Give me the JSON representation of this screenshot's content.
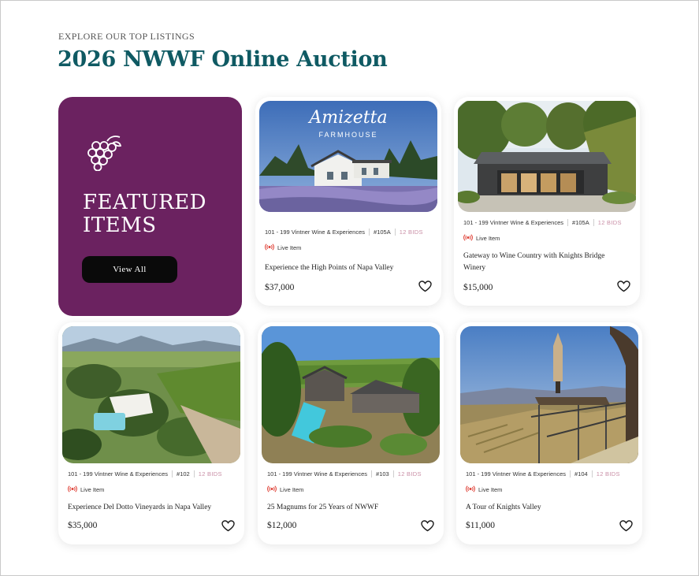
{
  "header": {
    "eyebrow": "EXPLORE OUR TOP LISTINGS",
    "title": "2026 NWWF Online Auction"
  },
  "featured": {
    "title_line1": "FEATURED",
    "title_line2": "ITEMS",
    "button_label": "View All",
    "bg_color": "#6b2260"
  },
  "cards": [
    {
      "category": "101 - 199 Vintner Wine & Experiences",
      "lot": "#105A",
      "bids": "12 BIDS",
      "status": "Live Item",
      "title": "Experience the High Points of Napa Valley",
      "price": "$37,000",
      "image_text1": "Amizetta",
      "image_text2": "FARMHOUSE",
      "image_text3": ""
    },
    {
      "category": "101 - 199 Vintner Wine & Experiences",
      "lot": "#105A",
      "bids": "12 BIDS",
      "status": "Live Item",
      "title": "Gateway to Wine Country with Knights Bridge Winery",
      "price": "$15,000"
    },
    {
      "category": "101 - 199 Vintner Wine & Experiences",
      "lot": "#102",
      "bids": "12 BIDS",
      "status": "Live Item",
      "title": "Experience Del Dotto Vineyards in Napa Valley",
      "price": "$35,000"
    },
    {
      "category": "101 - 199 Vintner Wine & Experiences",
      "lot": "#103",
      "bids": "12 BIDS",
      "status": "Live Item",
      "title": "25 Magnums for 25 Years of NWWF",
      "price": "$12,000"
    },
    {
      "category": "101 - 199 Vintner Wine & Experiences",
      "lot": "#104",
      "bids": "12 BIDS",
      "status": "Live Item",
      "title": "A Tour of Knights Valley",
      "price": "$11,000"
    }
  ],
  "icons": {
    "grape": "grape-icon",
    "live": "broadcast-icon",
    "favorite": "heart-icon"
  },
  "colors": {
    "title_teal": "#0f5a63",
    "bids_pink": "#c98fa6",
    "live_red": "#e0443a",
    "button_black": "#0a0a0a"
  }
}
